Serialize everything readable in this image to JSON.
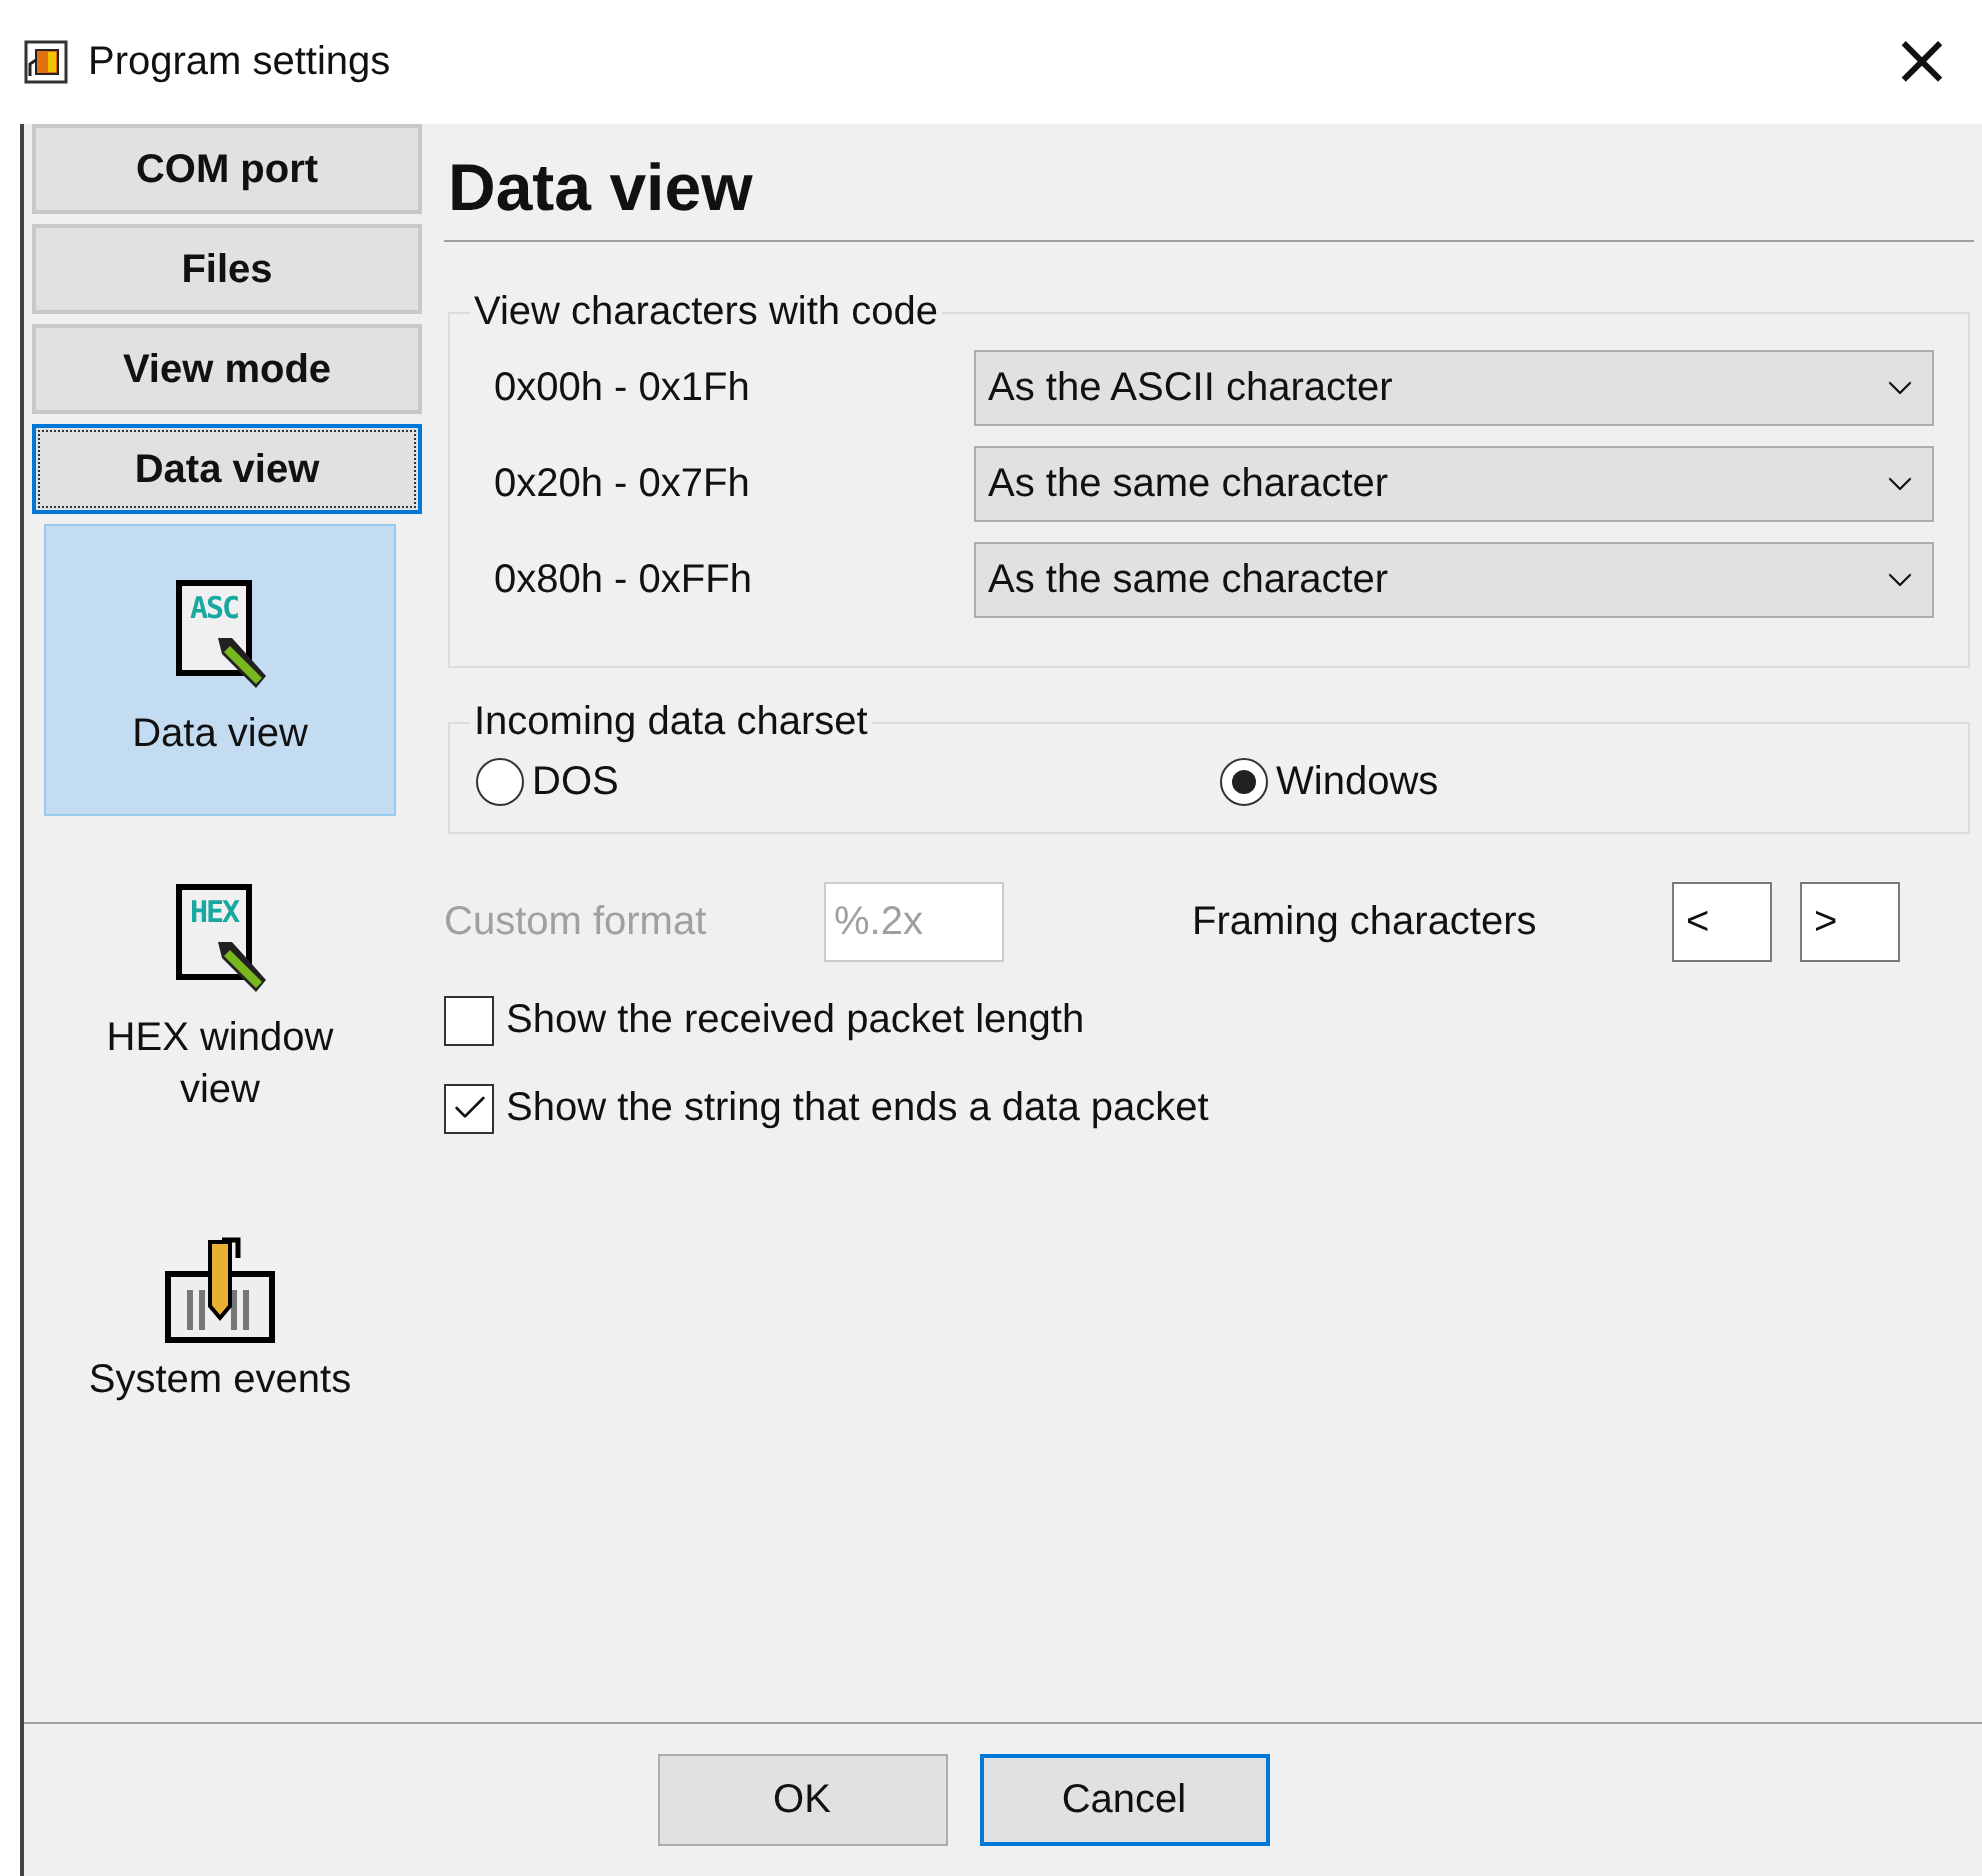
{
  "window": {
    "title": "Program settings",
    "close": "×"
  },
  "sidebar": {
    "tabs": [
      {
        "label": "COM port",
        "selected": false
      },
      {
        "label": "Files",
        "selected": false
      },
      {
        "label": "View mode",
        "selected": false
      },
      {
        "label": "Data view",
        "selected": true
      }
    ],
    "items": [
      {
        "label": "Data view",
        "kind": "document",
        "badge": "ASC",
        "selected": true
      },
      {
        "label": "HEX window view",
        "kind": "document",
        "badge": "HEX",
        "selected": false
      },
      {
        "label": "System events",
        "kind": "events",
        "selected": false
      }
    ]
  },
  "page": {
    "heading": "Data view",
    "codes": {
      "legend": "View characters with code",
      "rows": [
        {
          "range": "0x00h - 0x1Fh",
          "value": "As the ASCII character"
        },
        {
          "range": "0x20h - 0x7Fh",
          "value": "As the same character"
        },
        {
          "range": "0x80h - 0xFFh",
          "value": "As the same character"
        }
      ]
    },
    "charset": {
      "legend": "Incoming data charset",
      "options": [
        {
          "label": "DOS",
          "selected": false
        },
        {
          "label": "Windows",
          "selected": true
        }
      ]
    },
    "custom_format": {
      "label": "Custom format",
      "value": "%.2x",
      "disabled": true
    },
    "framing": {
      "label": "Framing characters",
      "fields": [
        "<",
        ">"
      ]
    },
    "checkboxes": [
      {
        "label": "Show the received packet length",
        "checked": false
      },
      {
        "label": "Show the string that ends a data packet",
        "checked": true
      }
    ]
  },
  "buttons": [
    {
      "label": "OK",
      "focused": false
    },
    {
      "label": "Cancel",
      "focused": true
    }
  ]
}
